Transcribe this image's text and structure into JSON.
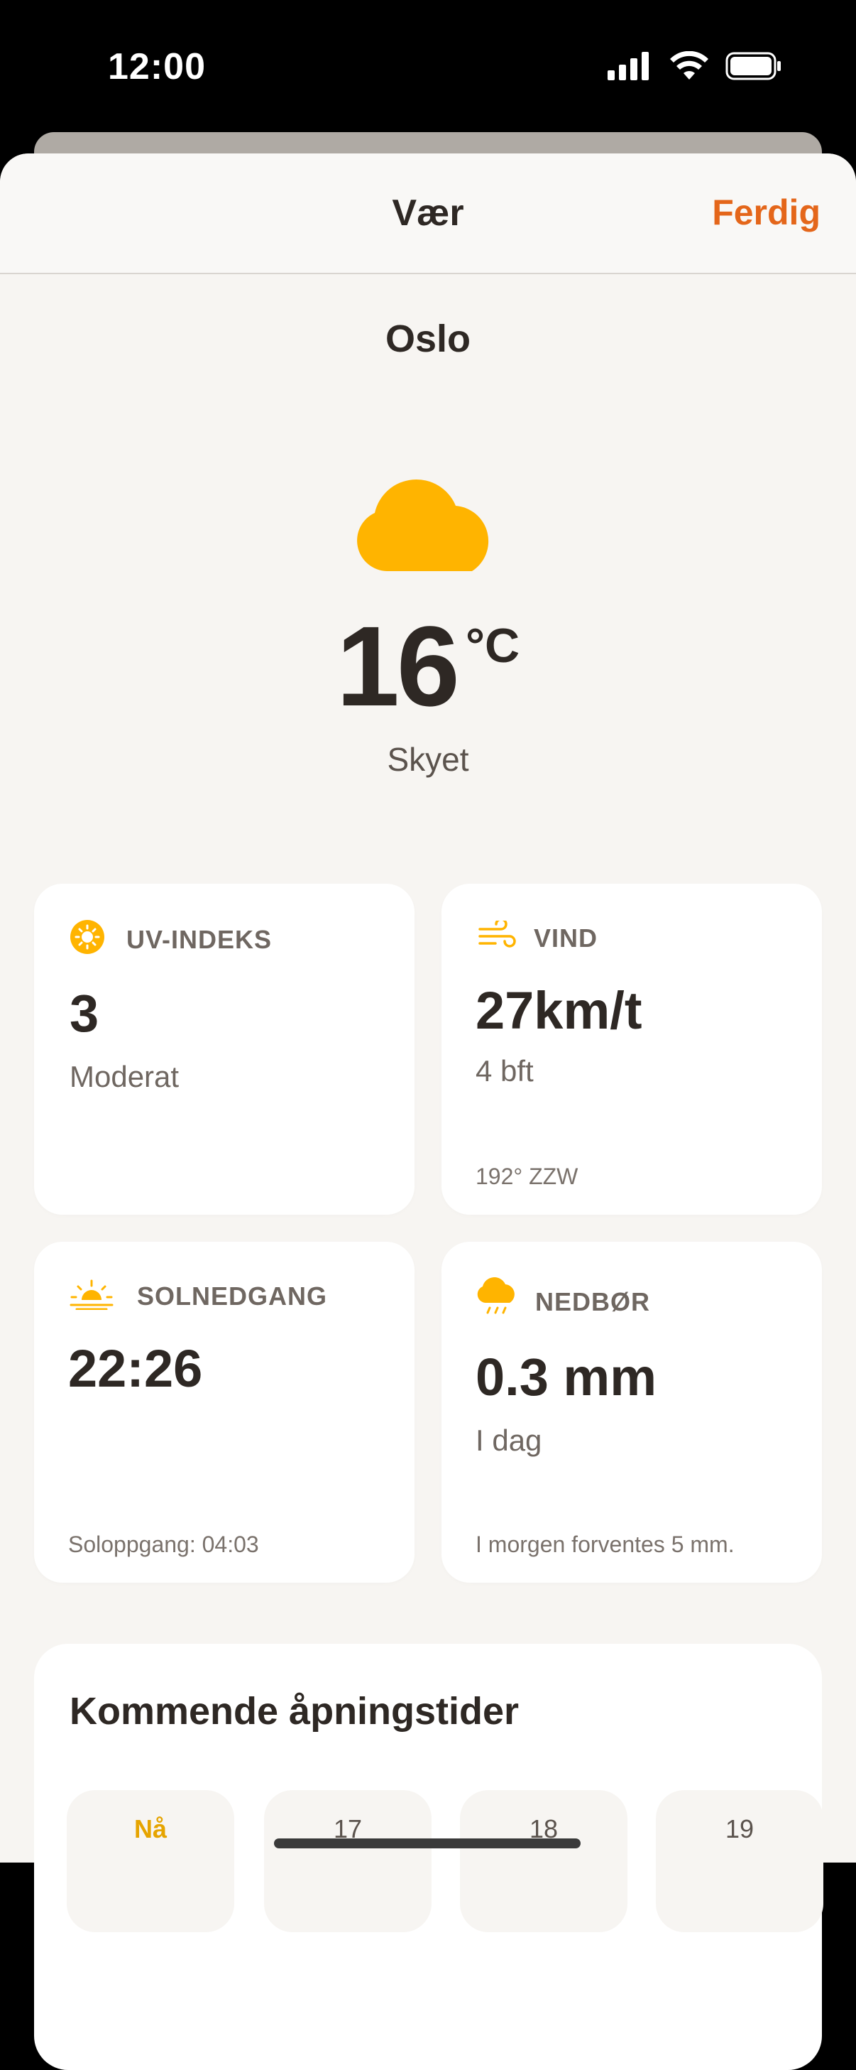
{
  "status_bar": {
    "time": "12:00"
  },
  "header": {
    "title": "Vær",
    "done_label": "Ferdig"
  },
  "location": {
    "city": "Oslo"
  },
  "current": {
    "temperature": "16",
    "unit": "°C",
    "condition": "Skyet"
  },
  "cards": {
    "uv": {
      "label": "UV-INDEKS",
      "value": "3",
      "sub": "Moderat"
    },
    "wind": {
      "label": "VIND",
      "value": "27km/t",
      "sub": "4 bft",
      "foot": "192° ZZW"
    },
    "sunset": {
      "label": "SOLNEDGANG",
      "value": "22:26",
      "foot": "Soloppgang: 04:03"
    },
    "precip": {
      "label": "NEDBØR",
      "value": "0.3 mm",
      "sub": "I dag",
      "foot": "I morgen forventes 5 mm."
    }
  },
  "upcoming": {
    "title": "Kommende åpningstider",
    "days": [
      "Nå",
      "17",
      "18",
      "19"
    ]
  },
  "colors": {
    "accent": "#E4661A",
    "weather_icon": "#FFB400",
    "text": "#2E2824",
    "background": "#F7F5F2"
  }
}
